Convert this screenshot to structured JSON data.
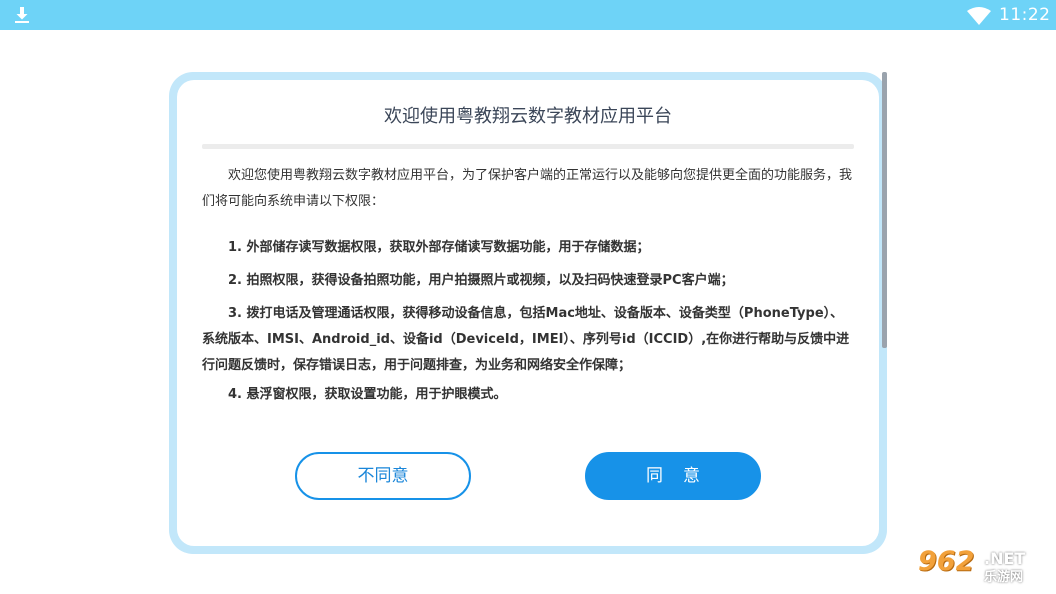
{
  "status_bar": {
    "time": "11:22",
    "download_icon": "download-icon",
    "wifi_icon": "wifi-icon",
    "color": "#6ed3f7"
  },
  "dialog": {
    "title": "欢迎使用粤教翔云数字教材应用平台",
    "intro": "欢迎您使用粤教翔云数字教材应用平台，为了保护客户端的正常运行以及能够向您提供更全面的功能服务，我们将可能向系统申请以下权限：",
    "permissions": [
      "1. 外部储存读写数据权限，获取外部存储读写数据功能，用于存储数据；",
      "2. 拍照权限，获得设备拍照功能，用户拍摄照片或视频，以及扫码快速登录PC客户端；",
      "3. 拨打电话及管理通话权限，获得移动设备信息，包括Mac地址、设备版本、设备类型（PhoneType）、系统版本、IMSI、Android_id、设备id（DeviceId，IMEI）、序列号id（ICCID）,在你进行帮助与反馈中进行问题反馈时，保存错误日志，用于问题排查，为业务和网络安全作保障；",
      "4. 悬浮窗权限，获取设置功能，用于护眼模式。"
    ],
    "disagree_label": "不同意",
    "agree_label": "同意",
    "accent_color": "#1792e8",
    "border_color": "#c2e7fa"
  },
  "watermark": {
    "number": "962",
    "domain": ".NET",
    "site": "乐游网"
  }
}
